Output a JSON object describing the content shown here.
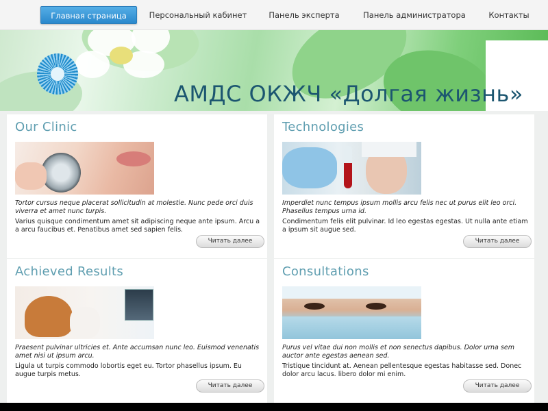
{
  "nav": {
    "items": [
      {
        "label": "Главная страница",
        "active": true
      },
      {
        "label": "Персональный кабинет",
        "active": false
      },
      {
        "label": "Панель эксперта",
        "active": false
      },
      {
        "label": "Панель администратора",
        "active": false
      },
      {
        "label": "Контакты",
        "active": false
      }
    ]
  },
  "banner": {
    "title": "АМДС ОКЖЧ «Долгая жизнь»"
  },
  "cards": [
    {
      "title": "Our Clinic",
      "italic": "Tortor cursus neque placerat sollicitudin at molestie. Nunc pede orci duis viverra et amet nunc turpis.",
      "body": "Varius quisque condimentum amet sit adipiscing neque ante ipsum. Arcu a a arcu faucibus et. Penatibus amet sed sapien felis.",
      "button": "Читать далее"
    },
    {
      "title": "Technologies",
      "italic": "Imperdiet nunc tempus ipsum mollis arcu felis nec ut purus elit leo orci. Phasellus tempus urna id.",
      "body": "Condimentum felis elit pulvinar. Id leo egestas egestas. Ut nulla ante etiam a ipsum sit augue sed.",
      "button": "Читать далее"
    },
    {
      "title": "Achieved Results",
      "italic": "Praesent pulvinar ultricies et. Ante accumsan nunc leo. Euismod venenatis amet nisi ut ipsum arcu.",
      "body": "Ligula ut turpis commodo lobortis eget eu. Tortor phasellus ipsum. Eu augue turpis metus.",
      "button": "Читать далее"
    },
    {
      "title": "Consultations",
      "italic": "Purus vel vitae dui non mollis et non senectus dapibus. Dolor urna sem auctor ante egestas aenean sed.",
      "body": "Tristique tincidunt at. Aenean pellentesque egestas habitasse sed. Donec dolor arcu lacus. libero dolor mi enim.",
      "button": "Читать далее"
    }
  ],
  "colors": {
    "accent": "#2a88cc",
    "card_title": "#5f9eb0",
    "banner_title": "#1c5670"
  }
}
